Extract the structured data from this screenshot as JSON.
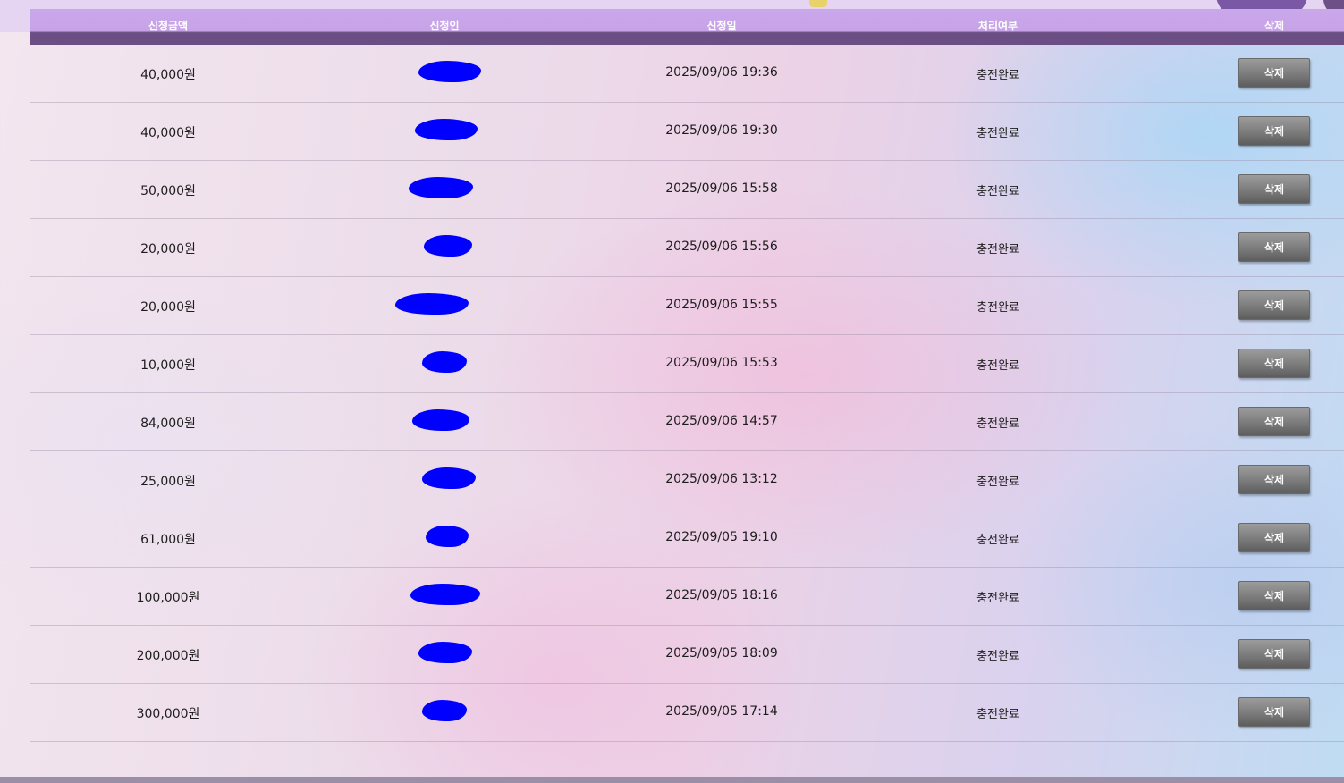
{
  "colors": {
    "header_bg": "#c9a8ea",
    "header_band": "#6b4f84",
    "redaction": "#0000ff",
    "button": "#7b7b7b"
  },
  "table": {
    "headers": {
      "amount": "신청금액",
      "applicant": "신청인",
      "date": "신청일",
      "status": "처리여부",
      "delete": "삭제"
    },
    "rows": [
      {
        "amount": "40,000원",
        "date": "2025/09/06 19:36",
        "status": "충전완료",
        "delete_label": "삭제"
      },
      {
        "amount": "40,000원",
        "date": "2025/09/06 19:30",
        "status": "충전완료",
        "delete_label": "삭제"
      },
      {
        "amount": "50,000원",
        "date": "2025/09/06 15:58",
        "status": "충전완료",
        "delete_label": "삭제"
      },
      {
        "amount": "20,000원",
        "date": "2025/09/06 15:56",
        "status": "충전완료",
        "delete_label": "삭제"
      },
      {
        "amount": "20,000원",
        "date": "2025/09/06 15:55",
        "status": "충전완료",
        "delete_label": "삭제"
      },
      {
        "amount": "10,000원",
        "date": "2025/09/06 15:53",
        "status": "충전완료",
        "delete_label": "삭제"
      },
      {
        "amount": "84,000원",
        "date": "2025/09/06 14:57",
        "status": "충전완료",
        "delete_label": "삭제"
      },
      {
        "amount": "25,000원",
        "date": "2025/09/06 13:12",
        "status": "충전완료",
        "delete_label": "삭제"
      },
      {
        "amount": "61,000원",
        "date": "2025/09/05 19:10",
        "status": "충전완료",
        "delete_label": "삭제"
      },
      {
        "amount": "100,000원",
        "date": "2025/09/05 18:16",
        "status": "충전완료",
        "delete_label": "삭제"
      },
      {
        "amount": "200,000원",
        "date": "2025/09/05 18:09",
        "status": "충전완료",
        "delete_label": "삭제"
      },
      {
        "amount": "300,000원",
        "date": "2025/09/05 17:14",
        "status": "충전완료",
        "delete_label": "삭제"
      }
    ]
  }
}
